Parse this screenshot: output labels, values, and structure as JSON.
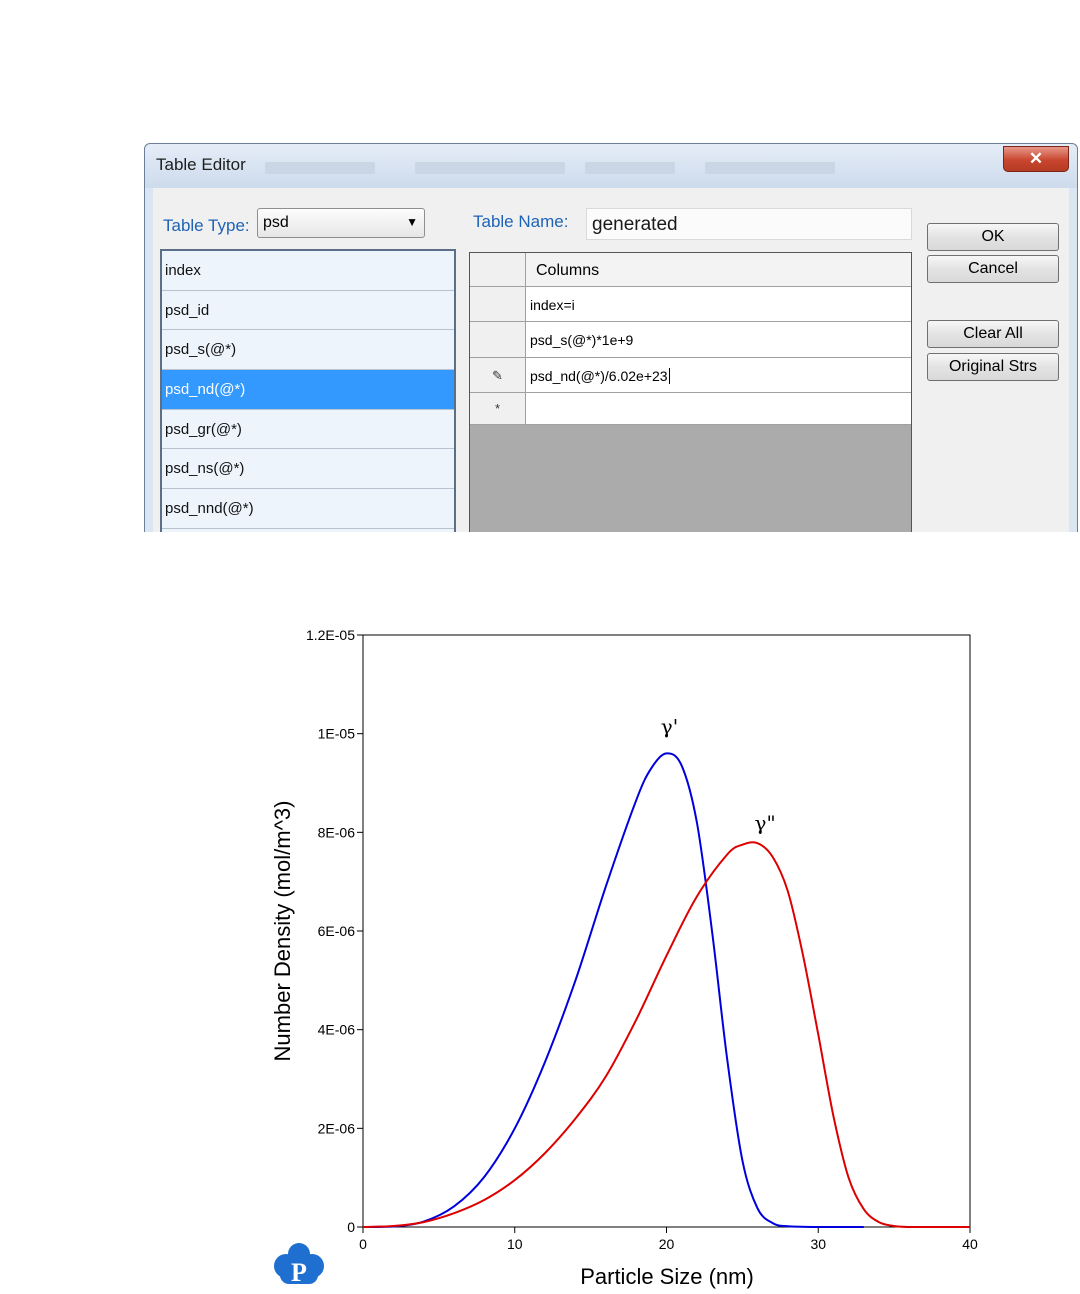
{
  "dialog": {
    "title": "Table Editor",
    "close_glyph": "✕",
    "table_type_label": "Table Type:",
    "table_type_value": "psd",
    "table_name_label": "Table Name:",
    "table_name_value": "generated",
    "list_items": [
      "index",
      "psd_id",
      "psd_s(@*)",
      "psd_nd(@*)",
      "psd_gr(@*)",
      "psd_ns(@*)",
      "psd_nnd(@*)"
    ],
    "selected_item": "psd_nd(@*)",
    "grid": {
      "header": "Columns",
      "rows": [
        {
          "marker": "",
          "value": "index=i"
        },
        {
          "marker": "",
          "value": "psd_s(@*)*1e+9"
        },
        {
          "marker": "✎",
          "value": "psd_nd(@*)/6.02e+23"
        },
        {
          "marker": "*",
          "value": ""
        }
      ]
    },
    "buttons": {
      "ok": "OK",
      "cancel": "Cancel",
      "clear_all": "Clear All",
      "original_strs": "Original Strs"
    }
  },
  "chart_data": {
    "type": "line",
    "xlabel": "Particle Size (nm)",
    "ylabel": "Number Density (mol/m^3)",
    "xlim": [
      0,
      40
    ],
    "ylim": [
      0,
      1.2e-05
    ],
    "xticks": [
      0,
      10,
      20,
      30,
      40
    ],
    "xtick_labels": [
      "0",
      "10",
      "20",
      "30",
      "40"
    ],
    "yticks": [
      0,
      2e-06,
      4e-06,
      6e-06,
      8e-06,
      1e-05,
      1.2e-05
    ],
    "ytick_labels": [
      "0",
      "2E-06",
      "4E-06",
      "6E-06",
      "8E-06",
      "1E-05",
      "1.2E-05"
    ],
    "grid": false,
    "series": [
      {
        "color": "#0000dd",
        "x": [
          0,
          2,
          4,
          6,
          8,
          10,
          12,
          14,
          16,
          18,
          19,
          20,
          21,
          22,
          23,
          24,
          25,
          26,
          27,
          28,
          30,
          33
        ],
        "y": [
          0,
          1e-08,
          1.1e-07,
          4.2e-07,
          1.02e-06,
          2e-06,
          3.35e-06,
          5e-06,
          6.9e-06,
          8.65e-06,
          9.3e-06,
          9.6e-06,
          9.35e-06,
          8.2e-06,
          6e-06,
          3.4e-06,
          1.35e-06,
          3.8e-07,
          8e-08,
          1.5e-08,
          0,
          0
        ]
      },
      {
        "color": "#dd0000",
        "x": [
          0,
          2,
          4,
          6,
          8,
          10,
          12,
          14,
          16,
          18,
          20,
          22,
          24,
          25,
          26,
          27,
          28,
          29,
          30,
          31,
          32,
          33,
          34,
          35,
          36,
          38,
          40
        ],
        "y": [
          0,
          2e-08,
          1e-07,
          2.8e-07,
          5.5e-07,
          9.5e-07,
          1.5e-06,
          2.2e-06,
          3.05e-06,
          4.2e-06,
          5.5e-06,
          6.7e-06,
          7.55e-06,
          7.75e-06,
          7.78e-06,
          7.5e-06,
          6.8e-06,
          5.5e-06,
          3.9e-06,
          2.25e-06,
          1e-06,
          3.6e-07,
          1e-07,
          2e-08,
          0,
          0,
          0
        ]
      }
    ],
    "annotations": [
      {
        "text": "γ'",
        "x": 20.2,
        "y": 1e-05
      },
      {
        "text": "γ\"",
        "x": 26.5,
        "y": 8.05e-06
      }
    ]
  }
}
